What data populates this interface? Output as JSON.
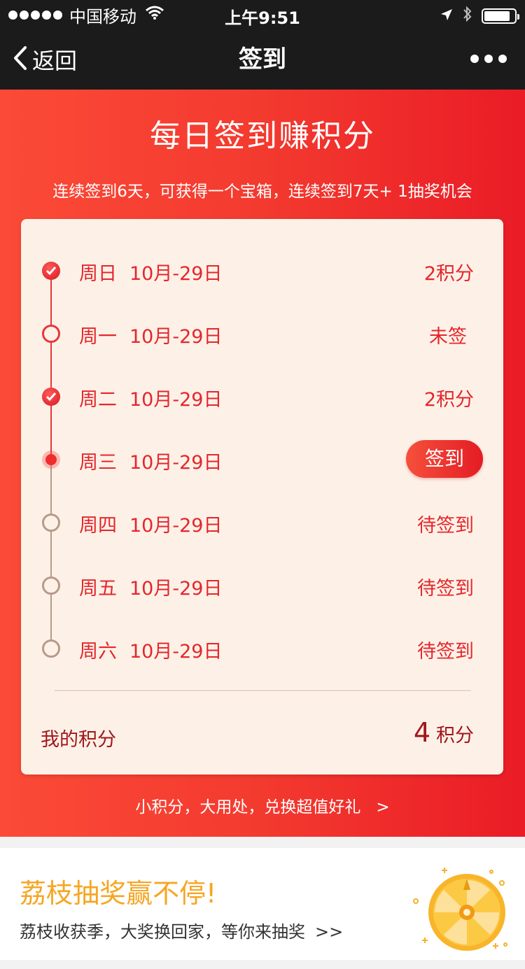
{
  "status_bar": {
    "carrier": "中国移动",
    "time": "上午9:51"
  },
  "nav": {
    "back_label": "返回",
    "title": "签到"
  },
  "hero": {
    "title": "每日签到赚积分",
    "subtitle": "连续签到6天，可获得一个宝箱，连续签到7天+ 1抽奖机会",
    "link_text": "小积分，大用处，兑换超值好礼",
    "link_arrow": ">"
  },
  "checkin": {
    "days": [
      {
        "weekday": "周日",
        "date": "10月-29日",
        "status": "2积分",
        "state": "checked"
      },
      {
        "weekday": "周一",
        "date": "10月-29日",
        "status": "未签",
        "state": "missed"
      },
      {
        "weekday": "周二",
        "date": "10月-29日",
        "status": "2积分",
        "state": "checked"
      },
      {
        "weekday": "周三",
        "date": "10月-29日",
        "status": "签到",
        "state": "today"
      },
      {
        "weekday": "周四",
        "date": "10月-29日",
        "status": "待签到",
        "state": "pending"
      },
      {
        "weekday": "周五",
        "date": "10月-29日",
        "status": "待签到",
        "state": "pending"
      },
      {
        "weekday": "周六",
        "date": "10月-29日",
        "status": "待签到",
        "state": "pending"
      }
    ],
    "my_points_label": "我的积分",
    "my_points_value": "4",
    "my_points_unit": "积分"
  },
  "promo": {
    "title": "荔枝抽奖赢不停!",
    "subtitle": "荔枝收获季，大奖换回家，等你来抽奖",
    "arrow": ">>"
  },
  "colors": {
    "hero_red": "#f33a2f",
    "accent_red": "#e5262c",
    "card_bg": "#fdf1e7",
    "promo_gold": "#f6a623"
  },
  "icons": [
    "signal-dots-icon",
    "wifi-icon",
    "location-arrow-icon",
    "bluetooth-icon",
    "battery-icon",
    "back-chevron-icon",
    "more-dots-icon",
    "check-icon",
    "lottery-wheel-icon"
  ]
}
